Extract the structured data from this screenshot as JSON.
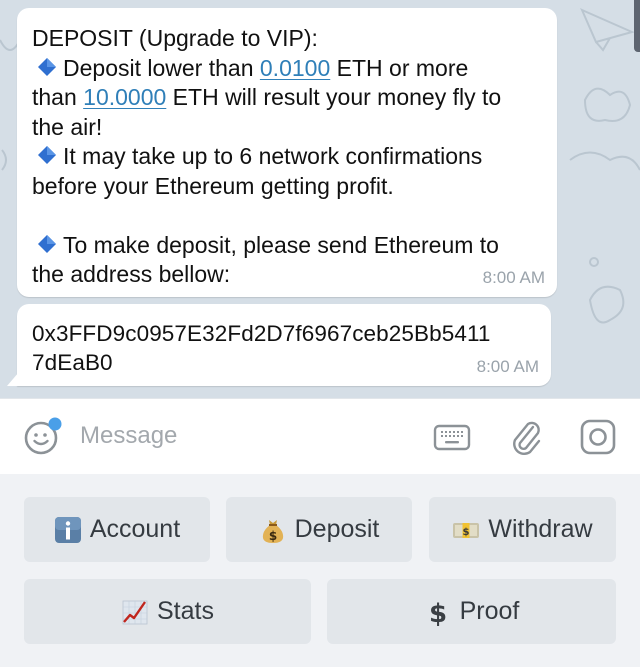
{
  "chat": {
    "messages": [
      {
        "title": "DEPOSIT (Upgrade to VIP):",
        "bullet1_prefix": "Deposit lower than ",
        "bullet1_min": "0.0100",
        "bullet1_mid": " ETH or more",
        "bullet1_line2_prefix": "than ",
        "bullet1_max": "10.0000",
        "bullet1_line2_suffix": " ETH will result your money fly to",
        "bullet1_line3": "the air!",
        "bullet2_line1": "It may take up to 6 network confirmations",
        "bullet2_line2": "before your Ethereum getting profit.",
        "bullet3_line1": "To make deposit, please send Ethereum to",
        "bullet3_line2": "the address bellow:",
        "time": "8:00 AM",
        "bullet_icon": "blue-diamond-icon"
      },
      {
        "address_line1": "0x3FFD9c0957E32Fd2D7f6967ceb25Bb5411",
        "address_line2": "7dEaB0",
        "time": "8:00 AM"
      }
    ]
  },
  "composer": {
    "placeholder": "Message",
    "icons": [
      "smiley-icon",
      "keyboard-icon",
      "paperclip-icon",
      "camera-icon"
    ],
    "notification_dot_color": "#4a9fe8"
  },
  "keyboard": {
    "rows": [
      [
        {
          "label": "Account",
          "icon": "information-icon"
        },
        {
          "label": "Deposit",
          "icon": "money-bag-icon"
        },
        {
          "label": "Withdraw",
          "icon": "banknote-icon"
        }
      ],
      [
        {
          "label": "Stats",
          "icon": "chart-increasing-icon"
        },
        {
          "label": "Proof",
          "icon": "dollar-sign-icon"
        }
      ]
    ]
  },
  "colors": {
    "link": "#2f7fb8",
    "chat_background": "#d5dee6",
    "bullet": "#2f6fd0"
  }
}
